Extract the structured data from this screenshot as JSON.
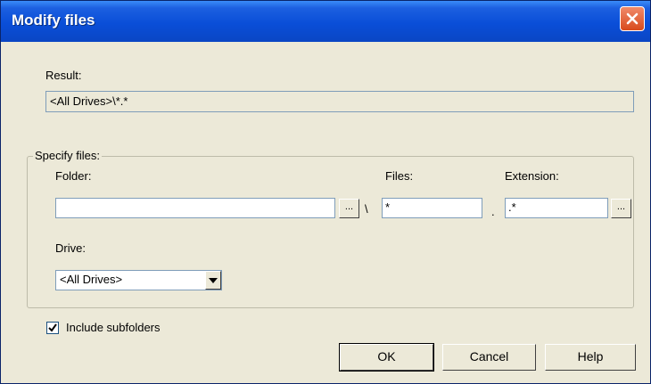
{
  "window": {
    "title": "Modify files"
  },
  "result": {
    "label": "Result:",
    "value": "<All Drives>\\*.*"
  },
  "specify": {
    "group_label": "Specify files:",
    "folder_label": "Folder:",
    "folder_value": "",
    "browse_folder": "...",
    "separator": "\\",
    "files_label": "Files:",
    "files_value": "*",
    "dot": ".",
    "extension_label": "Extension:",
    "extension_value": ".*",
    "browse_extension": "...",
    "drive_label": "Drive:",
    "drive_value": "<All Drives>"
  },
  "include_subfolders": {
    "label": "Include subfolders",
    "checked": true
  },
  "buttons": {
    "ok": "OK",
    "cancel": "Cancel",
    "help": "Help"
  },
  "colors": {
    "titlebar": "#0a4ed8",
    "close": "#d84a1c",
    "face": "#ece9d8"
  },
  "icons": {
    "close": "close-icon",
    "dropdown": "chevron-down-icon",
    "check": "checkmark-icon"
  }
}
